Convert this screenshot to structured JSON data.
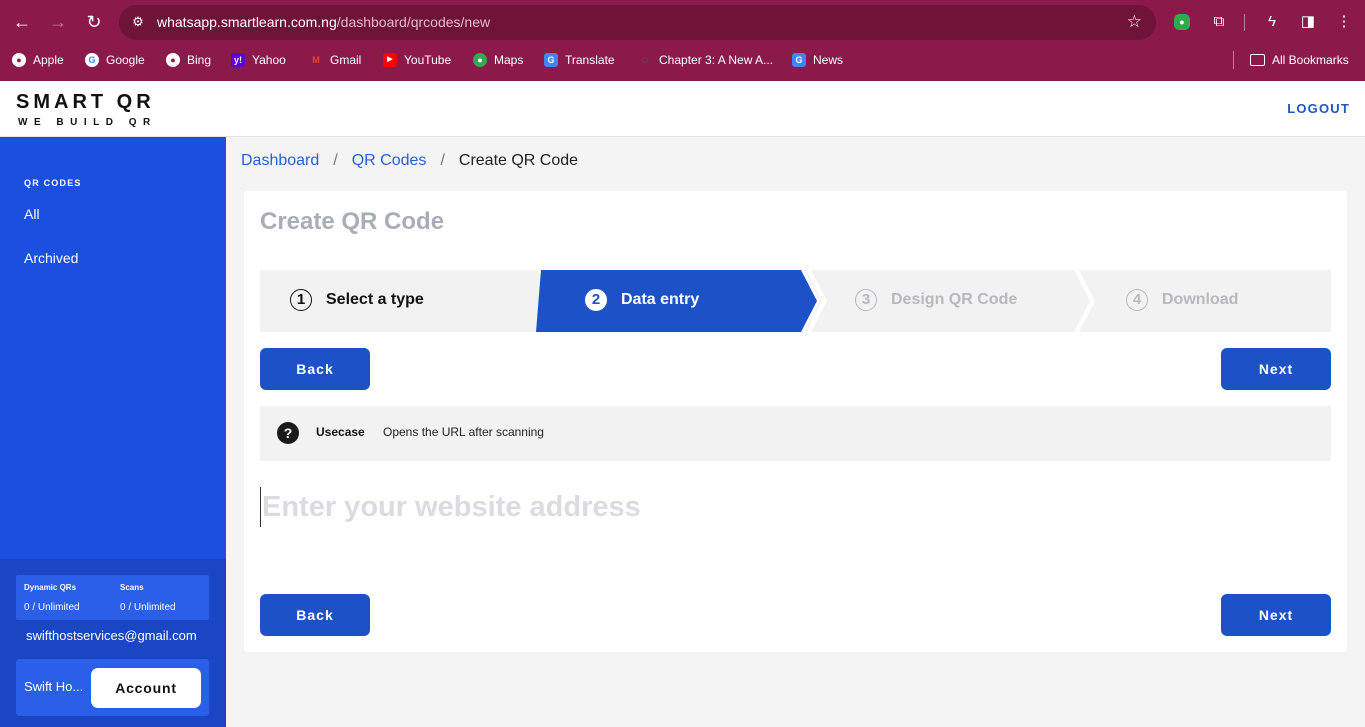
{
  "browser": {
    "url_host": "whatsapp.smartlearn.com.ng",
    "url_path": "/dashboard/qrcodes/new",
    "bookmarks": [
      {
        "label": "Apple",
        "color": "#ffffff",
        "glyph": "●"
      },
      {
        "label": "Google",
        "color": "#ffffff",
        "glyph": "G"
      },
      {
        "label": "Bing",
        "color": "#ffffff",
        "glyph": "●"
      },
      {
        "label": "Yahoo",
        "color": "#6001d2",
        "glyph": "y!"
      },
      {
        "label": "Gmail",
        "color": "#ea4335",
        "glyph": "M"
      },
      {
        "label": "YouTube",
        "color": "#ff0000",
        "glyph": "▶"
      },
      {
        "label": "Maps",
        "color": "#34a853",
        "glyph": "●"
      },
      {
        "label": "Translate",
        "color": "#4285f4",
        "glyph": "G"
      },
      {
        "label": "Chapter 3: A New A...",
        "color": "#555555",
        "glyph": "○"
      },
      {
        "label": "News",
        "color": "#4285f4",
        "glyph": "G"
      }
    ],
    "all_bookmarks": "All Bookmarks"
  },
  "app": {
    "logo_title": "SMART QR",
    "logo_sub": "WE BUILD QR",
    "logout": "LOGOUT"
  },
  "sidebar": {
    "heading": "QR CODES",
    "items": [
      "All",
      "Archived"
    ],
    "stats": {
      "dynamic_label": "Dynamic QRs",
      "dynamic_value": "0 / Unlimited",
      "scans_label": "Scans",
      "scans_value": "0 / Unlimited"
    },
    "email": "swifthostservices@gmail.com",
    "account_name": "Swift Ho...",
    "account_button": "Account"
  },
  "breadcrumb": {
    "items": [
      "Dashboard",
      "QR Codes"
    ],
    "current": "Create QR Code"
  },
  "page": {
    "title": "Create QR Code",
    "steps": [
      {
        "num": "1",
        "label": "Select a type",
        "state": "done"
      },
      {
        "num": "2",
        "label": "Data entry",
        "state": "active"
      },
      {
        "num": "3",
        "label": "Design QR Code",
        "state": "upcoming"
      },
      {
        "num": "4",
        "label": "Download",
        "state": "upcoming"
      }
    ],
    "back": "Back",
    "next": "Next",
    "usecase_label": "Usecase",
    "usecase_text": "Opens the URL after scanning",
    "website_placeholder": "Enter your website address",
    "website_value": ""
  },
  "colors": {
    "browser_frame": "#8b1a4b",
    "primary_blue": "#1d52c7",
    "sidebar_blue": "#1a4fe0"
  }
}
